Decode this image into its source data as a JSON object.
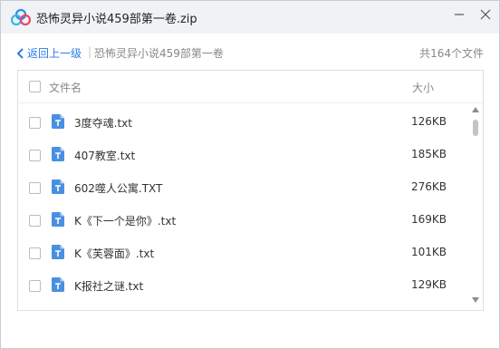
{
  "window": {
    "title": "恐怖灵异小说459部第一卷.zip",
    "icons": {
      "logo": "baidu-netdisk-logo-icon",
      "minimize": "minimize-icon",
      "close": "close-icon"
    }
  },
  "nav": {
    "back_label": "返回上一级",
    "separator": "|",
    "current_folder": "恐怖灵异小说459部第一卷",
    "file_count": "共164个文件"
  },
  "list": {
    "header": {
      "name": "文件名",
      "size": "大小"
    },
    "files": [
      {
        "name": "3度夺魂.txt",
        "size": "126KB"
      },
      {
        "name": "407教室.txt",
        "size": "185KB"
      },
      {
        "name": "602噬人公寓.TXT",
        "size": "276KB"
      },
      {
        "name": "K《下一个是你》.txt",
        "size": "169KB"
      },
      {
        "name": "K《芙蓉面》.txt",
        "size": "101KB"
      },
      {
        "name": "K报社之谜.txt",
        "size": "129KB"
      }
    ]
  },
  "colors": {
    "accent": "#2d7be4",
    "file_icon": "#4a90e2",
    "titlebar_bg": "#f0f2f5"
  }
}
